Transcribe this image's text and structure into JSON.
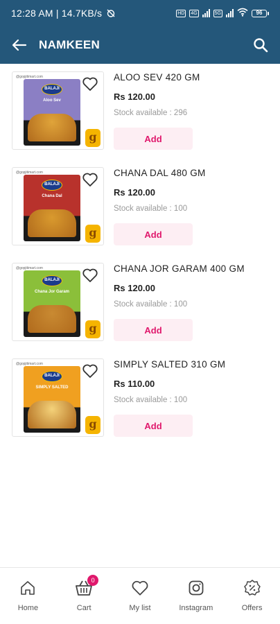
{
  "status_bar": {
    "time": "12:28 AM | 14.7KB/s",
    "network_1": "4G",
    "network_2": "5G",
    "battery": "96"
  },
  "app_bar": {
    "title": "NAMKEEN"
  },
  "products": [
    {
      "name": "ALOO SEV 420 GM",
      "price": "Rs 120.00",
      "stock": "Stock available : 296",
      "add_label": "Add",
      "pack_label": "Aloo Sev",
      "pack_color": "#8b7fc4",
      "snack_color": "#e0a43a"
    },
    {
      "name": "CHANA DAL 480 GM",
      "price": "Rs 120.00",
      "stock": "Stock available : 100",
      "add_label": "Add",
      "pack_label": "Chana Dal",
      "pack_color": "#b8322c",
      "snack_color": "#d99a2e"
    },
    {
      "name": "CHANA JOR GARAM 400 GM",
      "price": "Rs 120.00",
      "stock": "Stock available : 100",
      "add_label": "Add",
      "pack_label": "Chana Jor Garam",
      "pack_color": "#8bbf3a",
      "snack_color": "#c98a32"
    },
    {
      "name": "SIMPLY SALTED 310 GM",
      "price": "Rs 110.00",
      "stock": "Stock available : 100",
      "add_label": "Add",
      "pack_label": "SIMPLY SALTED",
      "pack_color": "#f0a020",
      "snack_color": "#f4d27a"
    }
  ],
  "bottom_nav": {
    "home": "Home",
    "cart": "Cart",
    "cart_count": "0",
    "mylist": "My list",
    "instagram": "Instagram",
    "offers": "Offers"
  },
  "colors": {
    "primary": "#24577a",
    "accent": "#e0186c",
    "add_bg": "#fdeef3"
  }
}
